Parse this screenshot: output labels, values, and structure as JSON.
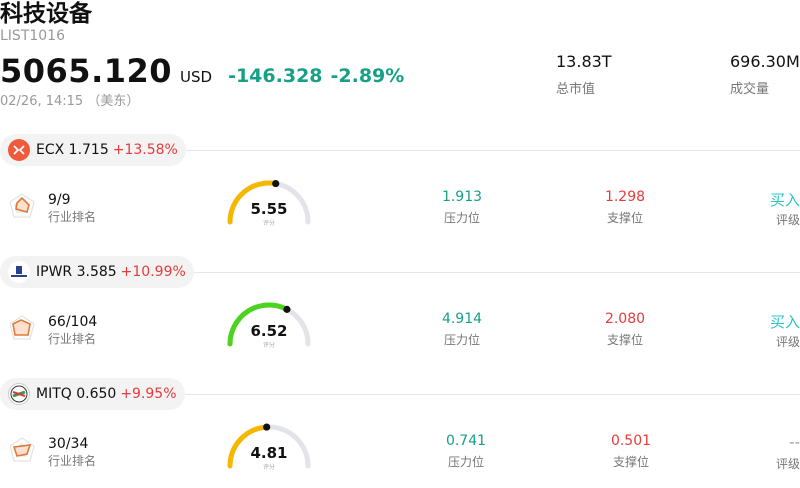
{
  "header": {
    "title": "科技设备",
    "code": "LIST1016",
    "price": "5065.120",
    "currency": "USD",
    "change": "-146.328",
    "change_pct": "-2.89%",
    "time": "02/26, 14:15 （美东）",
    "market_cap_value": "13.83T",
    "market_cap_label": "总市值",
    "volume_value": "696.30M",
    "volume_label": "成交量"
  },
  "stocks": [
    {
      "name": "ECX 1.715",
      "change_pct": "+13.58%",
      "logo_icon": "ecx-logo-icon",
      "rank": "9/9",
      "rank_label": "行业排名",
      "score": "5.55",
      "score_fraction": 0.555,
      "score_label": "评分",
      "gauge_color": "#f5b800",
      "resistance": "1.913",
      "resistance_label": "压力位",
      "support": "1.298",
      "support_label": "支撑位",
      "rating": "买入",
      "rating_label": "评级"
    },
    {
      "name": "IPWR 3.585",
      "change_pct": "+10.99%",
      "logo_icon": "ipwr-logo-icon",
      "rank": "66/104",
      "rank_label": "行业排名",
      "score": "6.52",
      "score_fraction": 0.652,
      "score_label": "评分",
      "gauge_color": "#4cd31e",
      "resistance": "4.914",
      "resistance_label": "压力位",
      "support": "2.080",
      "support_label": "支撑位",
      "rating": "买入",
      "rating_label": "评级"
    },
    {
      "name": "MITQ 0.650",
      "change_pct": "+9.95%",
      "logo_icon": "mitq-logo-icon",
      "rank": "30/34",
      "rank_label": "行业排名",
      "score": "4.81",
      "score_fraction": 0.481,
      "score_label": "评分",
      "gauge_color": "#f5b800",
      "resistance": "0.741",
      "resistance_label": "压力位",
      "support": "0.501",
      "support_label": "支撑位",
      "rating": "--",
      "rating_label": "评级"
    }
  ]
}
